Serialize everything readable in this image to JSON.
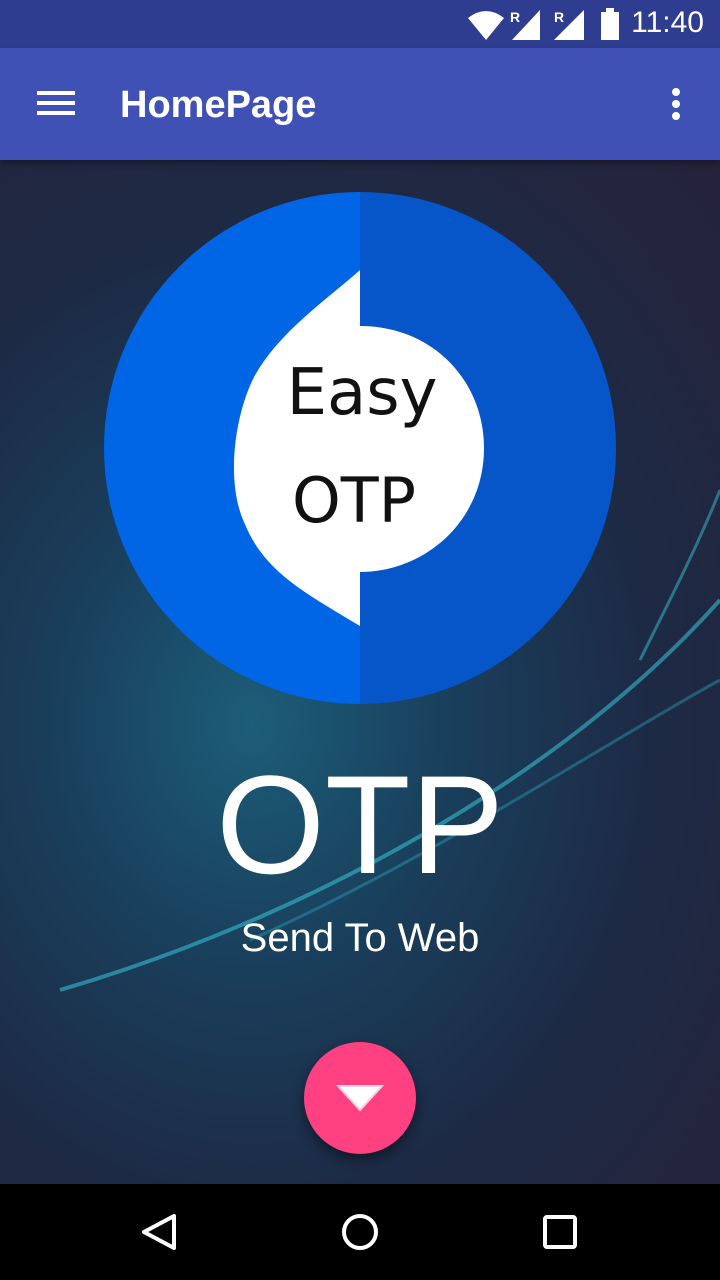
{
  "status_bar": {
    "time": "11:40",
    "icons": [
      "wifi-icon",
      "signal-roaming-icon",
      "signal-roaming-icon",
      "battery-icon"
    ],
    "roaming_mark": "R"
  },
  "app_bar": {
    "title": "HomePage",
    "menu_icon": "hamburger-menu-icon",
    "overflow_icon": "more-vert-icon",
    "color": "#3f51b5"
  },
  "logo": {
    "line1": "Easy",
    "line2": "OTP",
    "colors": {
      "left": "#0066e6",
      "right": "#0656c9",
      "inner": "#ffffff"
    }
  },
  "main": {
    "title": "OTP",
    "subtitle": "Send To Web"
  },
  "fab": {
    "icon": "arrow-down-icon",
    "color": "#ff4081"
  },
  "nav_bar": {
    "back_icon": "back-icon",
    "home_icon": "home-icon",
    "recents_icon": "recents-icon"
  }
}
